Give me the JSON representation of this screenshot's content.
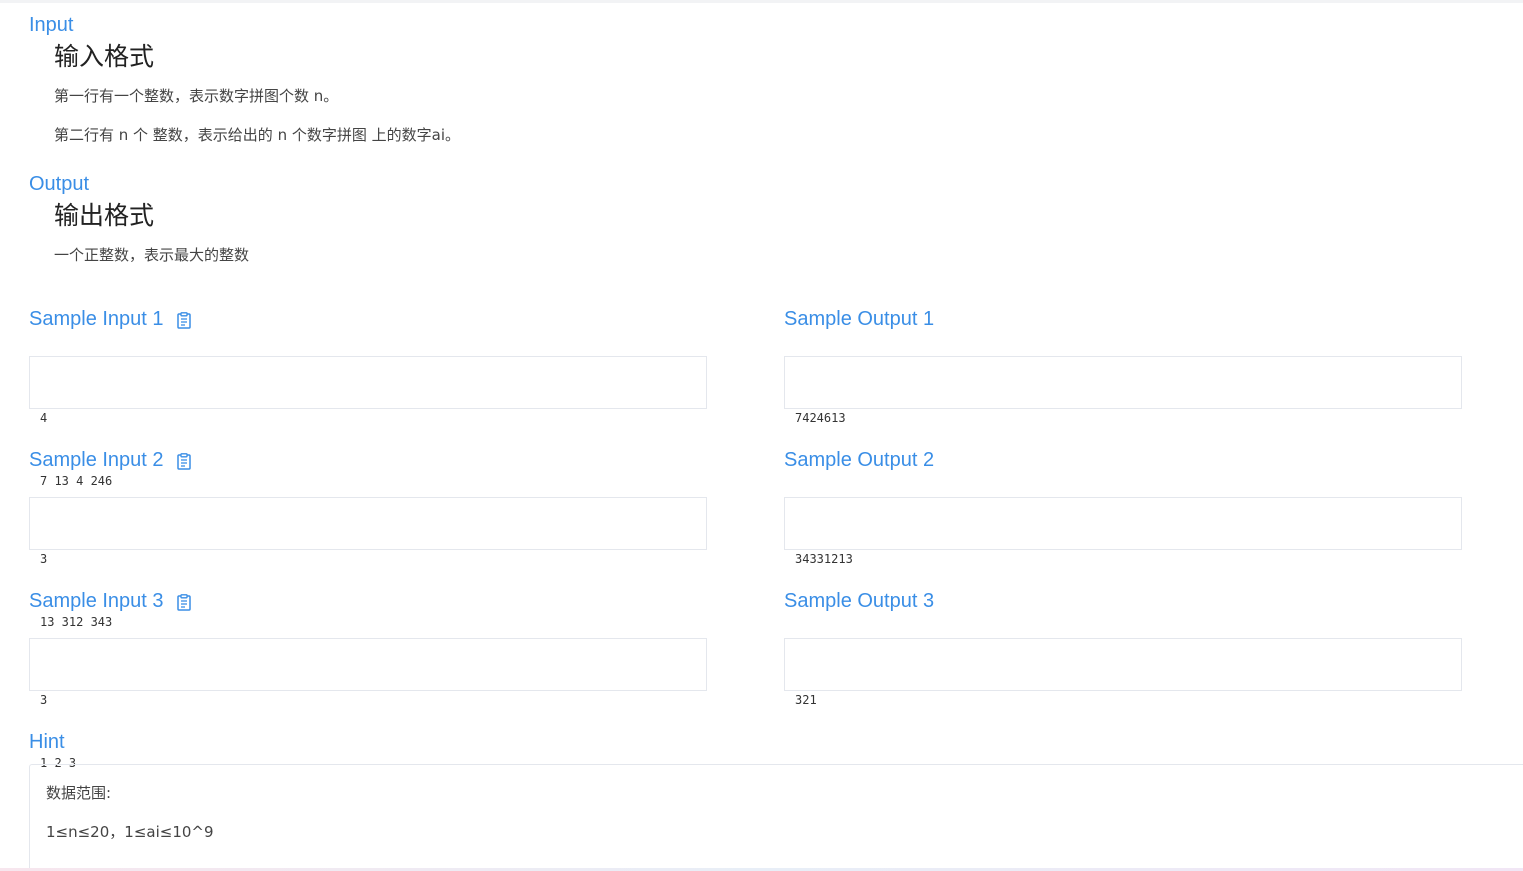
{
  "input_section": {
    "title": "Input",
    "heading": "输入格式",
    "lines": [
      "第一行有一个整数，表示数字拼图个数  n。",
      "第二行有 n 个 整数，表示给出的 n 个数字拼图 上的数字ai。"
    ]
  },
  "output_section": {
    "title": "Output",
    "heading": "输出格式",
    "lines": [
      "一个正整数，表示最大的整数"
    ]
  },
  "samples": [
    {
      "input_title": "Sample Input 1",
      "output_title": "Sample Output 1",
      "input_lines": [
        "4",
        "7 13 4 246"
      ],
      "output_lines": [
        "7424613"
      ]
    },
    {
      "input_title": "Sample Input 2",
      "output_title": "Sample Output 2",
      "input_lines": [
        "3",
        "13 312 343"
      ],
      "output_lines": [
        "34331213"
      ]
    },
    {
      "input_title": "Sample Input 3",
      "output_title": "Sample Output 3",
      "input_lines": [
        "3",
        "1 2 3"
      ],
      "output_lines": [
        "321"
      ]
    }
  ],
  "hint_section": {
    "title": "Hint",
    "lines": [
      "数据范围:",
      "1≤n≤20，1≤ai≤10^9"
    ]
  },
  "icons": {
    "copy": "clipboard-icon"
  },
  "colors": {
    "accent": "#3a8ee6",
    "border": "#e4e7ed",
    "text": "#333333"
  }
}
